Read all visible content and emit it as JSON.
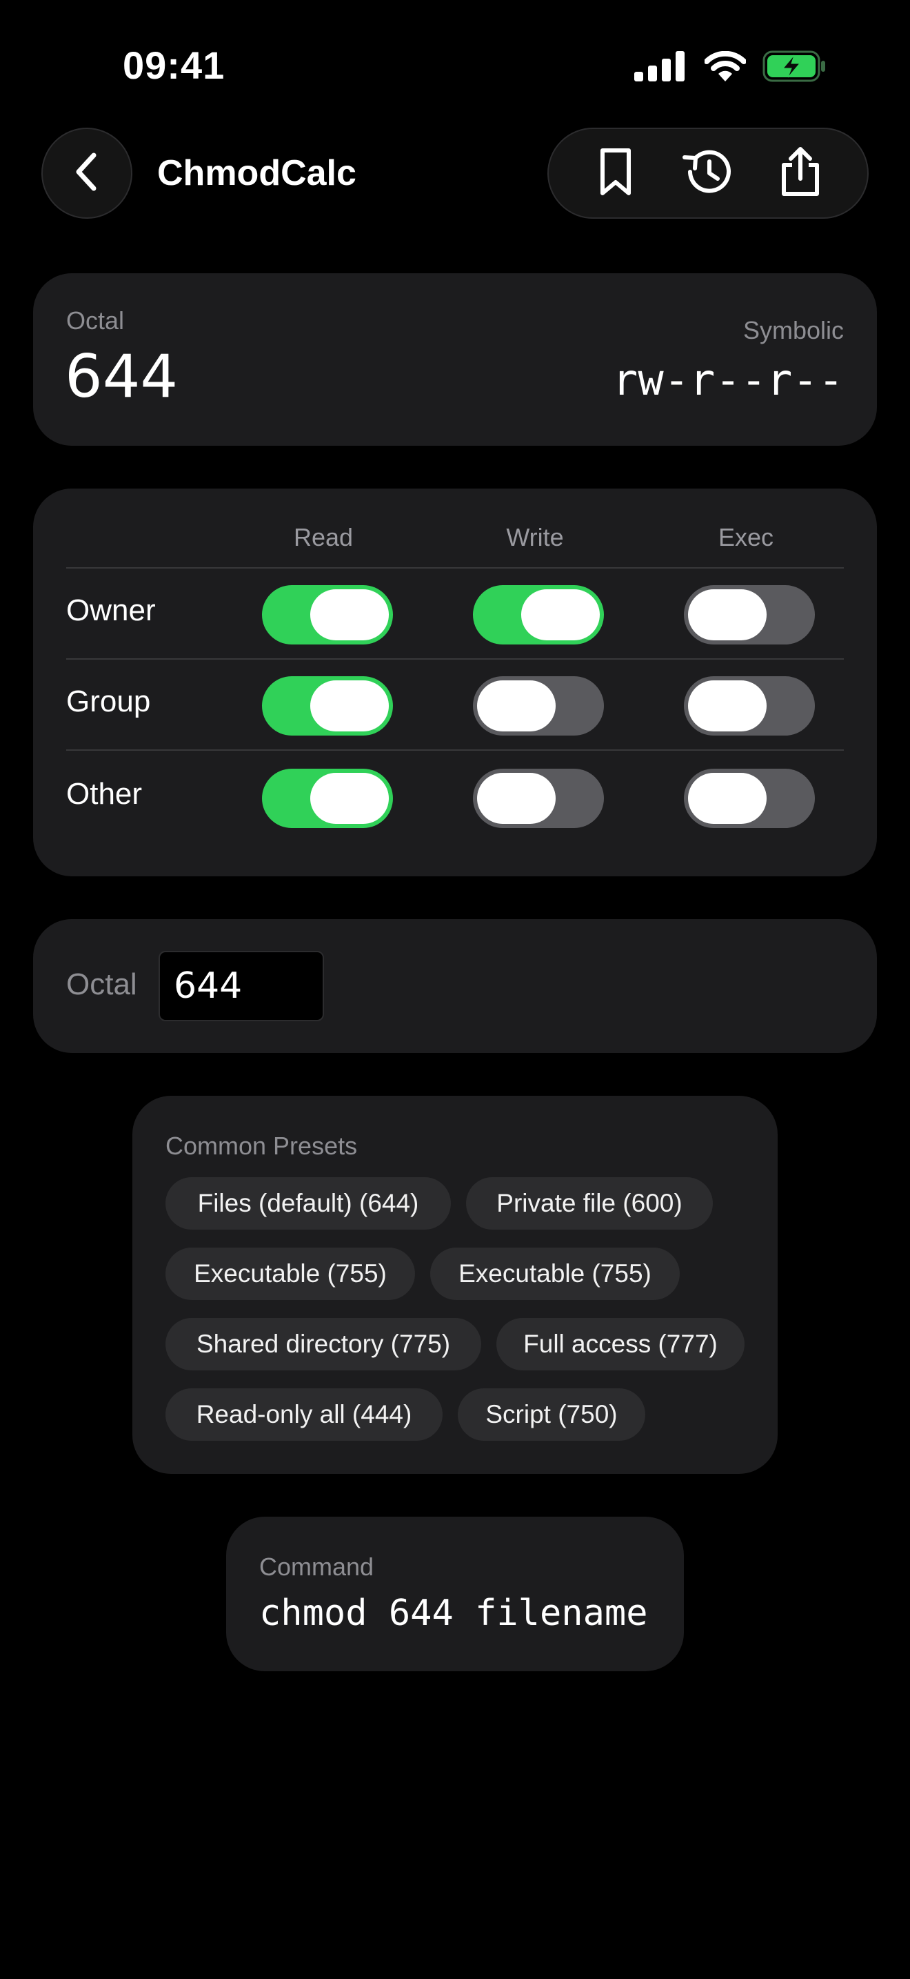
{
  "status_bar": {
    "time": "09:41",
    "icons": [
      "signal-icon",
      "wifi-icon",
      "battery-charging-icon"
    ],
    "battery_color": "#30d158"
  },
  "nav": {
    "title": "ChmodCalc",
    "icons": [
      "back-chevron-icon",
      "bookmark-icon",
      "history-icon",
      "share-icon"
    ]
  },
  "result": {
    "octal_label": "Octal",
    "octal_value": "644",
    "symbolic_label": "Symbolic",
    "symbolic_value": "rw-r--r--"
  },
  "permissions": {
    "columns": [
      "Read",
      "Write",
      "Exec"
    ],
    "rows": [
      {
        "label": "Owner",
        "read": true,
        "write": true,
        "exec": false
      },
      {
        "label": "Group",
        "read": true,
        "write": false,
        "exec": false
      },
      {
        "label": "Other",
        "read": true,
        "write": false,
        "exec": false
      }
    ],
    "on_color": "#30d158",
    "off_color": "#5a5a5e"
  },
  "octal_input": {
    "label": "Octal",
    "value": "644"
  },
  "presets": {
    "title": "Common Presets",
    "items": [
      "Files (default) (644)",
      "Private file (600)",
      "Executable (755)",
      "Executable (755)",
      "Shared directory (775)",
      "Full access (777)",
      "Read-only all (444)",
      "Script (750)"
    ]
  },
  "command": {
    "label": "Command",
    "value": "chmod 644 filename"
  }
}
